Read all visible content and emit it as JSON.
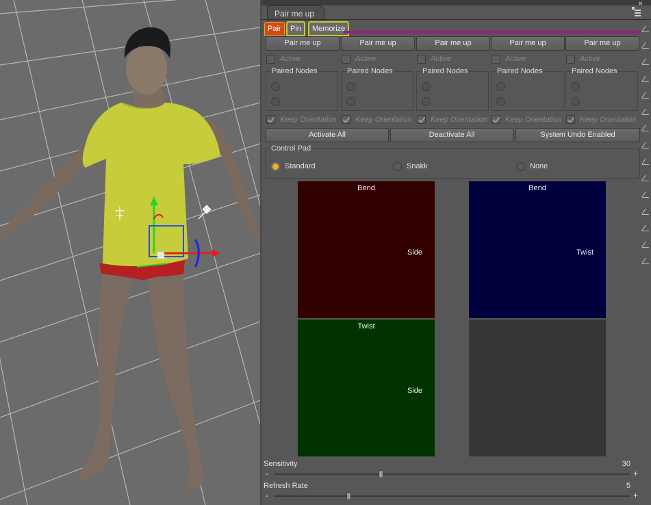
{
  "pane": {
    "tab_label": "Pair me up",
    "close_glyph": "×"
  },
  "subtabs": [
    {
      "label": "Pair",
      "selected": true
    },
    {
      "label": "Pin",
      "selected": false
    },
    {
      "label": "Memorize",
      "selected": false
    }
  ],
  "columns": [
    {
      "button": "Pair me up",
      "active_label": "Active",
      "paired_label": "Paired Nodes",
      "keep_label": "Keep Orientation"
    },
    {
      "button": "Pair me up",
      "active_label": "Active",
      "paired_label": "Paired Nodes",
      "keep_label": "Keep Orientation"
    },
    {
      "button": "Pair me up",
      "active_label": "Active",
      "paired_label": "Paired Nodes",
      "keep_label": "Keep Orientation"
    },
    {
      "button": "Pair me up",
      "active_label": "Active",
      "paired_label": "Paired Nodes",
      "keep_label": "Keep Orientation"
    },
    {
      "button": "Pair me up",
      "active_label": "Active",
      "paired_label": "Paired Nodes",
      "keep_label": "Keep Orientation"
    }
  ],
  "actions": {
    "activate_all": "Activate All",
    "deactivate_all": "Deactivate All",
    "system_undo": "System Undo Enabled"
  },
  "control_pad": {
    "title": "Control Pad",
    "options": [
      {
        "label": "Standard",
        "selected": true
      },
      {
        "label": "Snakk",
        "selected": false
      },
      {
        "label": "None",
        "selected": false
      }
    ]
  },
  "pads": [
    {
      "top_label": "Bend",
      "side_label": "Side",
      "color": "#330000"
    },
    {
      "top_label": "Bend",
      "side_label": "Twist",
      "color": "#00003d"
    },
    {
      "top_label": "Twist",
      "side_label": "Side",
      "color": "#003300"
    },
    {
      "top_label": "",
      "side_label": "",
      "color": "#363636"
    }
  ],
  "sliders": {
    "sensitivity": {
      "label": "Sensitivity",
      "value": "30",
      "fraction": 0.3
    },
    "refresh_rate": {
      "label": "Refresh Rate",
      "value": "5",
      "fraction": 0.21
    }
  },
  "colors": {
    "accent_orange": "#d24a12",
    "accent_purple": "#9a1b8a",
    "radio_selected": "#f0b020"
  }
}
